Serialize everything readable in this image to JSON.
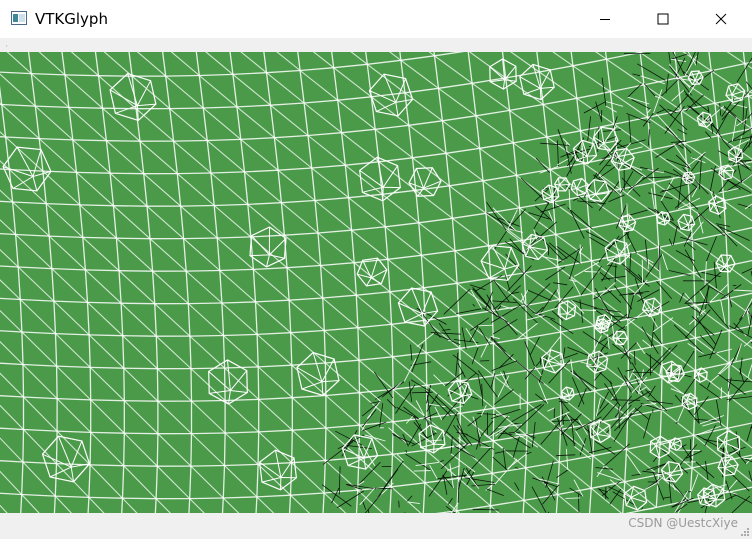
{
  "window": {
    "title": "VTKGlyph",
    "app_icon": "app-window-icon",
    "controls": [
      "minimize-icon",
      "maximize-icon",
      "close-icon"
    ]
  },
  "menubar": {
    "marker": ","
  },
  "viewport": {
    "background_color": "#4a9a4a",
    "wireframe_color": "#ffffff",
    "dense_mesh_color": "#000000"
  },
  "status": {
    "watermark": "CSDN @UestcXiye"
  }
}
